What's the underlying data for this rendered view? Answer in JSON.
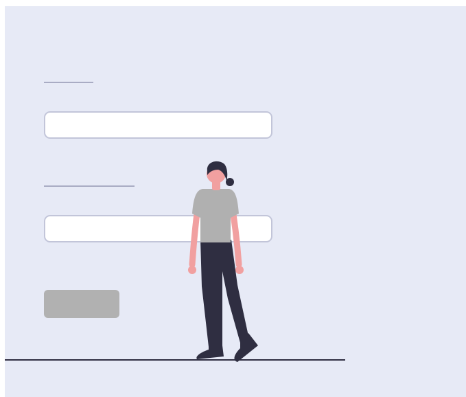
{
  "form": {
    "field_1": {
      "value": "",
      "placeholder": ""
    },
    "field_2": {
      "value": "",
      "placeholder": ""
    },
    "submit_label": ""
  },
  "colors": {
    "background": "#e7eaf6",
    "field_border": "#c2c5d9",
    "label_placeholder": "#a9acc4",
    "button": "#b1b1b1",
    "ground_line": "#2f2e41",
    "skin": "#f1a0a0",
    "shirt": "#b0b0b0",
    "pants_hair_shoes": "#2f2e41"
  },
  "illustration": {
    "subject": "woman-walking",
    "icon": "person-walking-icon"
  }
}
